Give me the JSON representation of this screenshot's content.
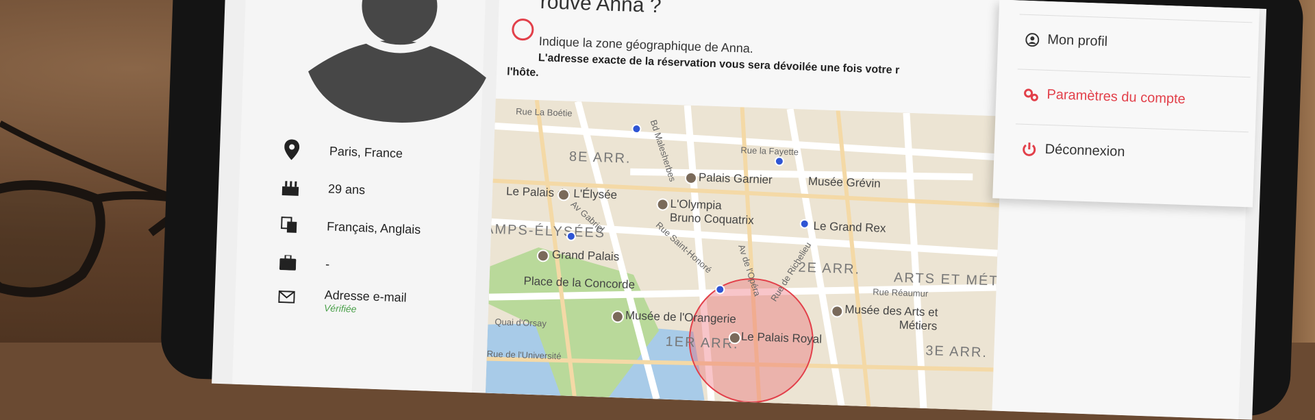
{
  "profile": {
    "location": "Paris, France",
    "age": "29 ans",
    "languages": "Français, Anglais",
    "job": "-",
    "email_label": "Adresse e-mail",
    "email_status": "Vérifiée"
  },
  "main": {
    "heading": "rouve Anna ?",
    "instruction": "Indique la zone géographique de Anna.",
    "notice": "L'adresse exacte de la réservation vous sera dévoilée une fois votre r",
    "notice_end": "l'hôte."
  },
  "menu": {
    "profile": "Mon profil",
    "settings": "Paramètres du compte",
    "logout": "Déconnexion"
  },
  "map": {
    "labels": {
      "arr8": "8E ARR.",
      "arr2": "2E ARR.",
      "arr1": "1ER ARR.",
      "arr3": "3E ARR.",
      "champs": "AMPS-ÉLYSÉES",
      "arts": "ARTS ET MÉTIERS",
      "elysee": "Le Palais de L'Élysée",
      "garnier": "Palais Garnier",
      "olympia1": "L'Olympia",
      "olympia2": "Bruno Coquatrix",
      "grevin": "Musée Grévin",
      "grandrex": "Le Grand Rex",
      "grandpalais": "Grand Palais",
      "concorde": "Place de la Concorde",
      "orangerie": "Musée de l'Orangerie",
      "palaisroyal": "Le Palais Royal",
      "artsmetiers1": "Musée des Arts et",
      "artsmetiers2": "Métiers",
      "boetie": "Rue La Boétie",
      "lafayette": "Rue la Fayette",
      "malesherbes": "Bd Malesherbes",
      "gabriel": "Av Gabriel",
      "sthonore": "Rue Saint-Honoré",
      "opera": "Av de l'Opéra",
      "richelieu": "Rue de Richelieu",
      "reaumur": "Rue Réaumur",
      "orsay": "Quai d'Orsay",
      "universite": "Rue de l'Université"
    }
  },
  "colors": {
    "accent": "#e2404a",
    "verified": "#4aa04a"
  }
}
